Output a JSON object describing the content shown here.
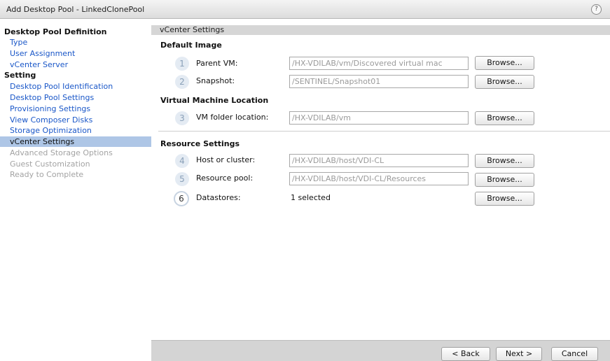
{
  "window": {
    "title": "Add Desktop Pool - LinkedClonePool",
    "help_icon": "?"
  },
  "sidebar": {
    "items": [
      {
        "label": "Desktop Pool Definition",
        "state": "heading"
      },
      {
        "label": "Type",
        "state": "link"
      },
      {
        "label": "User Assignment",
        "state": "link"
      },
      {
        "label": "vCenter Server",
        "state": "link"
      },
      {
        "label": "Setting",
        "state": "heading"
      },
      {
        "label": "Desktop Pool Identification",
        "state": "link"
      },
      {
        "label": "Desktop Pool Settings",
        "state": "link"
      },
      {
        "label": "Provisioning Settings",
        "state": "link"
      },
      {
        "label": "View Composer Disks",
        "state": "link"
      },
      {
        "label": "Storage Optimization",
        "state": "link"
      },
      {
        "label": "vCenter Settings",
        "state": "active"
      },
      {
        "label": "Advanced Storage Options",
        "state": "disabled"
      },
      {
        "label": "Guest Customization",
        "state": "disabled"
      },
      {
        "label": "Ready to Complete",
        "state": "disabled"
      }
    ]
  },
  "main": {
    "header": "vCenter Settings",
    "sections": {
      "default_image": "Default Image",
      "vm_location": "Virtual Machine Location",
      "resource_settings": "Resource Settings"
    },
    "fields": [
      {
        "step": "1",
        "label": "Parent VM:",
        "value": "/HX-VDILAB/vm/Discovered virtual mac",
        "browse": "Browse..."
      },
      {
        "step": "2",
        "label": "Snapshot:",
        "value": "/SENTINEL/Snapshot01",
        "browse": "Browse..."
      },
      {
        "step": "3",
        "label": "VM folder location:",
        "value": "/HX-VDILAB/vm",
        "browse": "Browse..."
      },
      {
        "step": "4",
        "label": "Host or cluster:",
        "value": "/HX-VDILAB/host/VDI-CL",
        "browse": "Browse..."
      },
      {
        "step": "5",
        "label": "Resource pool:",
        "value": "/HX-VDILAB/host/VDI-CL/Resources",
        "browse": "Browse..."
      },
      {
        "step": "6",
        "label": "Datastores:",
        "value": "1 selected",
        "browse": "Browse..."
      }
    ]
  },
  "footer": {
    "back": "< Back",
    "next": "Next >",
    "cancel": "Cancel"
  },
  "colors": {
    "active_nav": "#aec6e6",
    "link": "#1a57c8",
    "disabled": "#a3a3a3"
  }
}
